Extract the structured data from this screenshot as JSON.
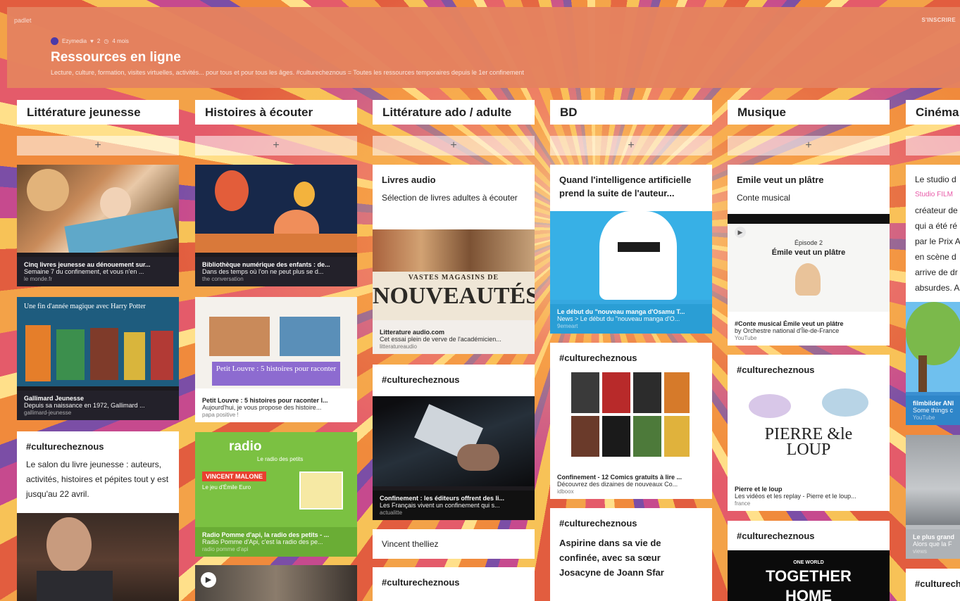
{
  "header": {
    "logo": "padlet",
    "signin": "S'INSCRIRE",
    "author": "Ezymedia",
    "likes": "2",
    "age": "4 mois",
    "title": "Ressources en ligne",
    "subtitle": "Lecture, culture, formation, visites virtuelles, activités... pour tous et pour tous les âges. #culturecheznous = Toutes les ressources temporaires depuis le 1er confinement",
    "accent": "#e4825f"
  },
  "add_symbol": "+",
  "columns": [
    {
      "title": "Littérature jeunesse",
      "cards": [
        {
          "title": "Cinq livres jeunesse au dénouement sur...",
          "desc": "Semaine 7 du confinement, et vous n'en ...",
          "source": "le monde.fr"
        },
        {
          "title": "Gallimard Jeunesse",
          "desc": "Depuis sa naissance en 1972, Gallimard ...",
          "source": "gallimard-jeunesse",
          "image_text": "Une fin d'année magique avec Harry Potter"
        },
        {
          "title": "#culturecheznous",
          "body": "Le salon du livre jeunesse : auteurs, activités, histoires et pépites tout y est jusqu'au 22 avril."
        }
      ]
    },
    {
      "title": "Histoires à écouter",
      "cards": [
        {
          "title": "Bibliothèque numérique des enfants : de...",
          "desc": "Dans des temps où l'on ne peut plus se d...",
          "source": "the conversation"
        },
        {
          "title": "Petit Louvre : 5 histoires pour raconter l...",
          "desc": "Aujourd'hui, je vous propose des histoire...",
          "source": "papa positive !",
          "image_text": "Petit Louvre : 5 histoires pour raconter"
        },
        {
          "title": "Radio Pomme d'api, la radio des petits - ...",
          "desc": "Radio Pomme d'Api, c'est la radio des pe...",
          "source": "radio pomme d'api",
          "image_text": "radio",
          "image_sub": "Le radio des petits",
          "image_tag": "VINCENT MALONE",
          "image_tag2": "Le jeu d'Émile Euro"
        }
      ]
    },
    {
      "title": "Littérature ado / adulte",
      "cards": [
        {
          "title": "Livres audio",
          "body": "Sélection de livres adultes à écouter"
        },
        {
          "title": "Litterature audio.com",
          "desc": "Cet essai plein de verve de l'académicien...",
          "source": "litteratureaudio",
          "image_text": "NOUVEAUTÉS",
          "image_sub": "VASTES MAGASINS DE"
        },
        {
          "title": "#culturecheznous"
        },
        {
          "title": "Confinement : les éditeurs offrent des li...",
          "desc": "Les Français vivent un confinement qui s...",
          "source": "actualitte"
        },
        {
          "title": "Vincent thelliez"
        },
        {
          "title": "#culturecheznous"
        }
      ]
    },
    {
      "title": "BD",
      "cards": [
        {
          "title": "Quand l'intelligence artificielle prend la suite de l'auteur..."
        },
        {
          "title": "Le début du \"nouveau manga d'Osamu T...",
          "desc": "News > Le début du \"nouveau manga d'O...",
          "source": "9emeart"
        },
        {
          "title": "#culturecheznous"
        },
        {
          "title": "Confinement - 12 Comics gratuits à lire ...",
          "desc": "Découvrez des dizaines de nouveaux Co...",
          "source": "idboox"
        },
        {
          "title": "#culturecheznous",
          "body": "Aspirine dans sa vie de confinée, avec sa sœur Josacyne de Joann Sfar"
        }
      ]
    },
    {
      "title": "Musique",
      "cards": [
        {
          "title": "Emile veut un plâtre",
          "body": "Conte musical"
        },
        {
          "title": "#Conte musical Émile veut un plâtre",
          "desc": "by Orchestre national d'Île-de-France",
          "source": "YouTube",
          "image_text": "Émile veut un plâtre",
          "image_sub": "Épisode 2"
        },
        {
          "title": "#culturecheznous"
        },
        {
          "title": "Pierre et le loup",
          "desc": "Les vidéos et les replay - Pierre et le loup...",
          "source": "france",
          "image_text": "PIERRE &le LOUP"
        },
        {
          "title": "#culturecheznous",
          "image_text": "TOGETHER",
          "image_sub": "ONE WORLD",
          "image_tag": "HOME"
        }
      ]
    },
    {
      "title": "Cinéma",
      "cards": [
        {
          "title": "Le studio d",
          "body_lines": [
            "Studio FILM",
            "créateur de",
            "qui a été ré",
            "par le Prix A",
            "en scène d",
            "arrive de dr",
            "absurdes. A"
          ]
        },
        {
          "title": "filmbilder ANI",
          "desc": "Some things c",
          "source": "YouTube"
        },
        {
          "title": "Le plus grand",
          "desc": "Alors que la F",
          "source": "views"
        },
        {
          "title": "#culturech"
        }
      ]
    }
  ]
}
